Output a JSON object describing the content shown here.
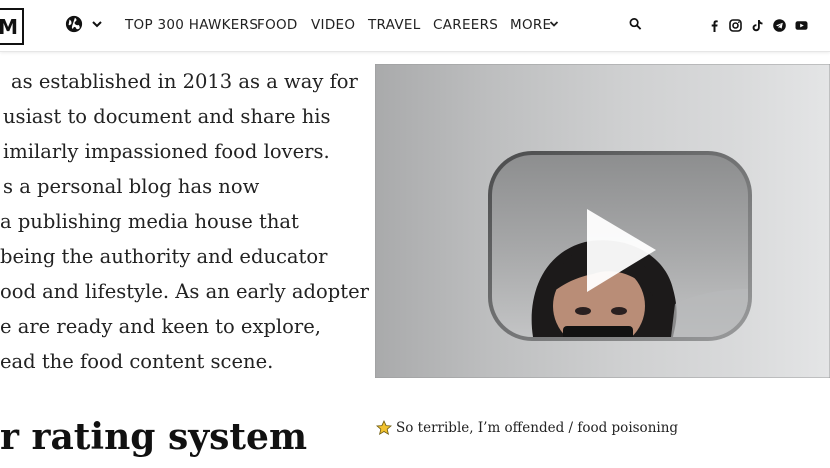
{
  "header": {
    "logo_letter": "M",
    "nav": [
      "TOP 300 HAWKERS",
      "FOOD",
      "VIDEO",
      "TRAVEL",
      "CAREERS",
      "MORE"
    ],
    "icons": {
      "globe": "globe-icon",
      "search": "search-icon",
      "social": [
        "facebook-icon",
        "instagram-icon",
        "tiktok-icon",
        "telegram-icon",
        "youtube-icon"
      ]
    }
  },
  "article": {
    "lines": [
      "as established in 2013 as a way for",
      "usiast to document and share his",
      "imilarly impassioned food lovers.",
      "s a personal blog has now",
      " a publishing media house that",
      " being the authority and educator",
      "ood and lifestyle. As an early adopter",
      "e are ready and keen to explore,",
      "ead the food content scene."
    ],
    "heading_partial": "r rating system"
  },
  "video": {
    "media": "video-player",
    "control_icon": "play-icon"
  },
  "rating": {
    "icon": "star-icon",
    "star_color": "#f2c230",
    "text": "So terrible, I’m offended / food poisoning"
  }
}
